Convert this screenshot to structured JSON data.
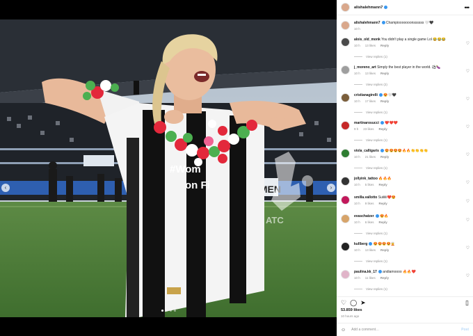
{
  "post": {
    "author": "alishalehmann7",
    "caption": "Champiooooooonssssss",
    "caption_emoji": "🤍🖤",
    "caption_age": "10 h",
    "likes": "53.859 likes",
    "posted": "10 hours ago",
    "add_comment_placeholder": "Add a comment…",
    "post_label": "Post",
    "more_icon": "•••",
    "media_text": {
      "banner": "#Wom",
      "banner2": "on Fi",
      "watermark": "ATC",
      "side": "OMEN"
    }
  },
  "colors": {
    "verified": "#3897f0",
    "muted": "#8e8e8e",
    "stripe_black": "#111111",
    "flower_red": "#e3283b",
    "flower_green": "#4caf50"
  },
  "comments": [
    {
      "user": "alois_old_monk",
      "verified": false,
      "text": " You didn't play a single game Lol 😂😂😂",
      "time": "10 h",
      "likes": "13 likes",
      "reply": "Reply",
      "view": "View replies (1)",
      "av": "#4a4a4a"
    },
    {
      "user": "j_moreno_art",
      "verified": false,
      "text": " Simply the best player in the world. ⚽🍆",
      "time": "10 h",
      "likes": "13 likes",
      "reply": "Reply",
      "view": "View replies (2)",
      "av": "#9e9e9e"
    },
    {
      "user": "cristianagirelli",
      "verified": true,
      "text": " 😍🤍🖤",
      "time": "10 h",
      "likes": "17 likes",
      "reply": "Reply",
      "view": "View replies (1)",
      "av": "#7b5e3b"
    },
    {
      "user": "martinarosucci",
      "verified": true,
      "text": " ❤️❤️❤️",
      "time": "9 h",
      "likes": "23 likes",
      "reply": "Reply",
      "view": "View replies (1)",
      "av": "#c62828"
    },
    {
      "user": "viola_calligaris",
      "verified": true,
      "text": " 😍😍😍😍🔥🔥👏👏👏👏",
      "time": "10 h",
      "likes": "21 likes",
      "reply": "Reply",
      "view": "View replies (1)",
      "av": "#2e7d32"
    },
    {
      "user": "jollyink_tattoo",
      "verified": false,
      "text": " 🔥🔥🔥",
      "time": "10 h",
      "likes": "5 likes",
      "reply": "Reply",
      "view": "",
      "av": "#333333"
    },
    {
      "user": "smilla.vallotto",
      "verified": false,
      "text": " Suiiiiii❤️😍",
      "time": "10 h",
      "likes": "9 likes",
      "reply": "Reply",
      "view": "",
      "av": "#c2185b"
    },
    {
      "user": "evaschatzer",
      "verified": true,
      "text": " 😍🔥",
      "time": "10 h",
      "likes": "6 likes",
      "reply": "Reply",
      "view": "View replies (1)",
      "av": "#d7a46a"
    },
    {
      "user": "kullberg",
      "verified": true,
      "text": " 😍😍😍😍🧝",
      "time": "10 h",
      "likes": "13 likes",
      "reply": "Reply",
      "view": "View replies (1)",
      "av": "#222222"
    },
    {
      "user": "paulina.kk_17",
      "verified": true,
      "text": " andiamoooo 🔥🔥❤️",
      "time": "10 h",
      "likes": "11 likes",
      "reply": "Reply",
      "view": "View replies (1)",
      "av": "#e0b4c8"
    }
  ]
}
